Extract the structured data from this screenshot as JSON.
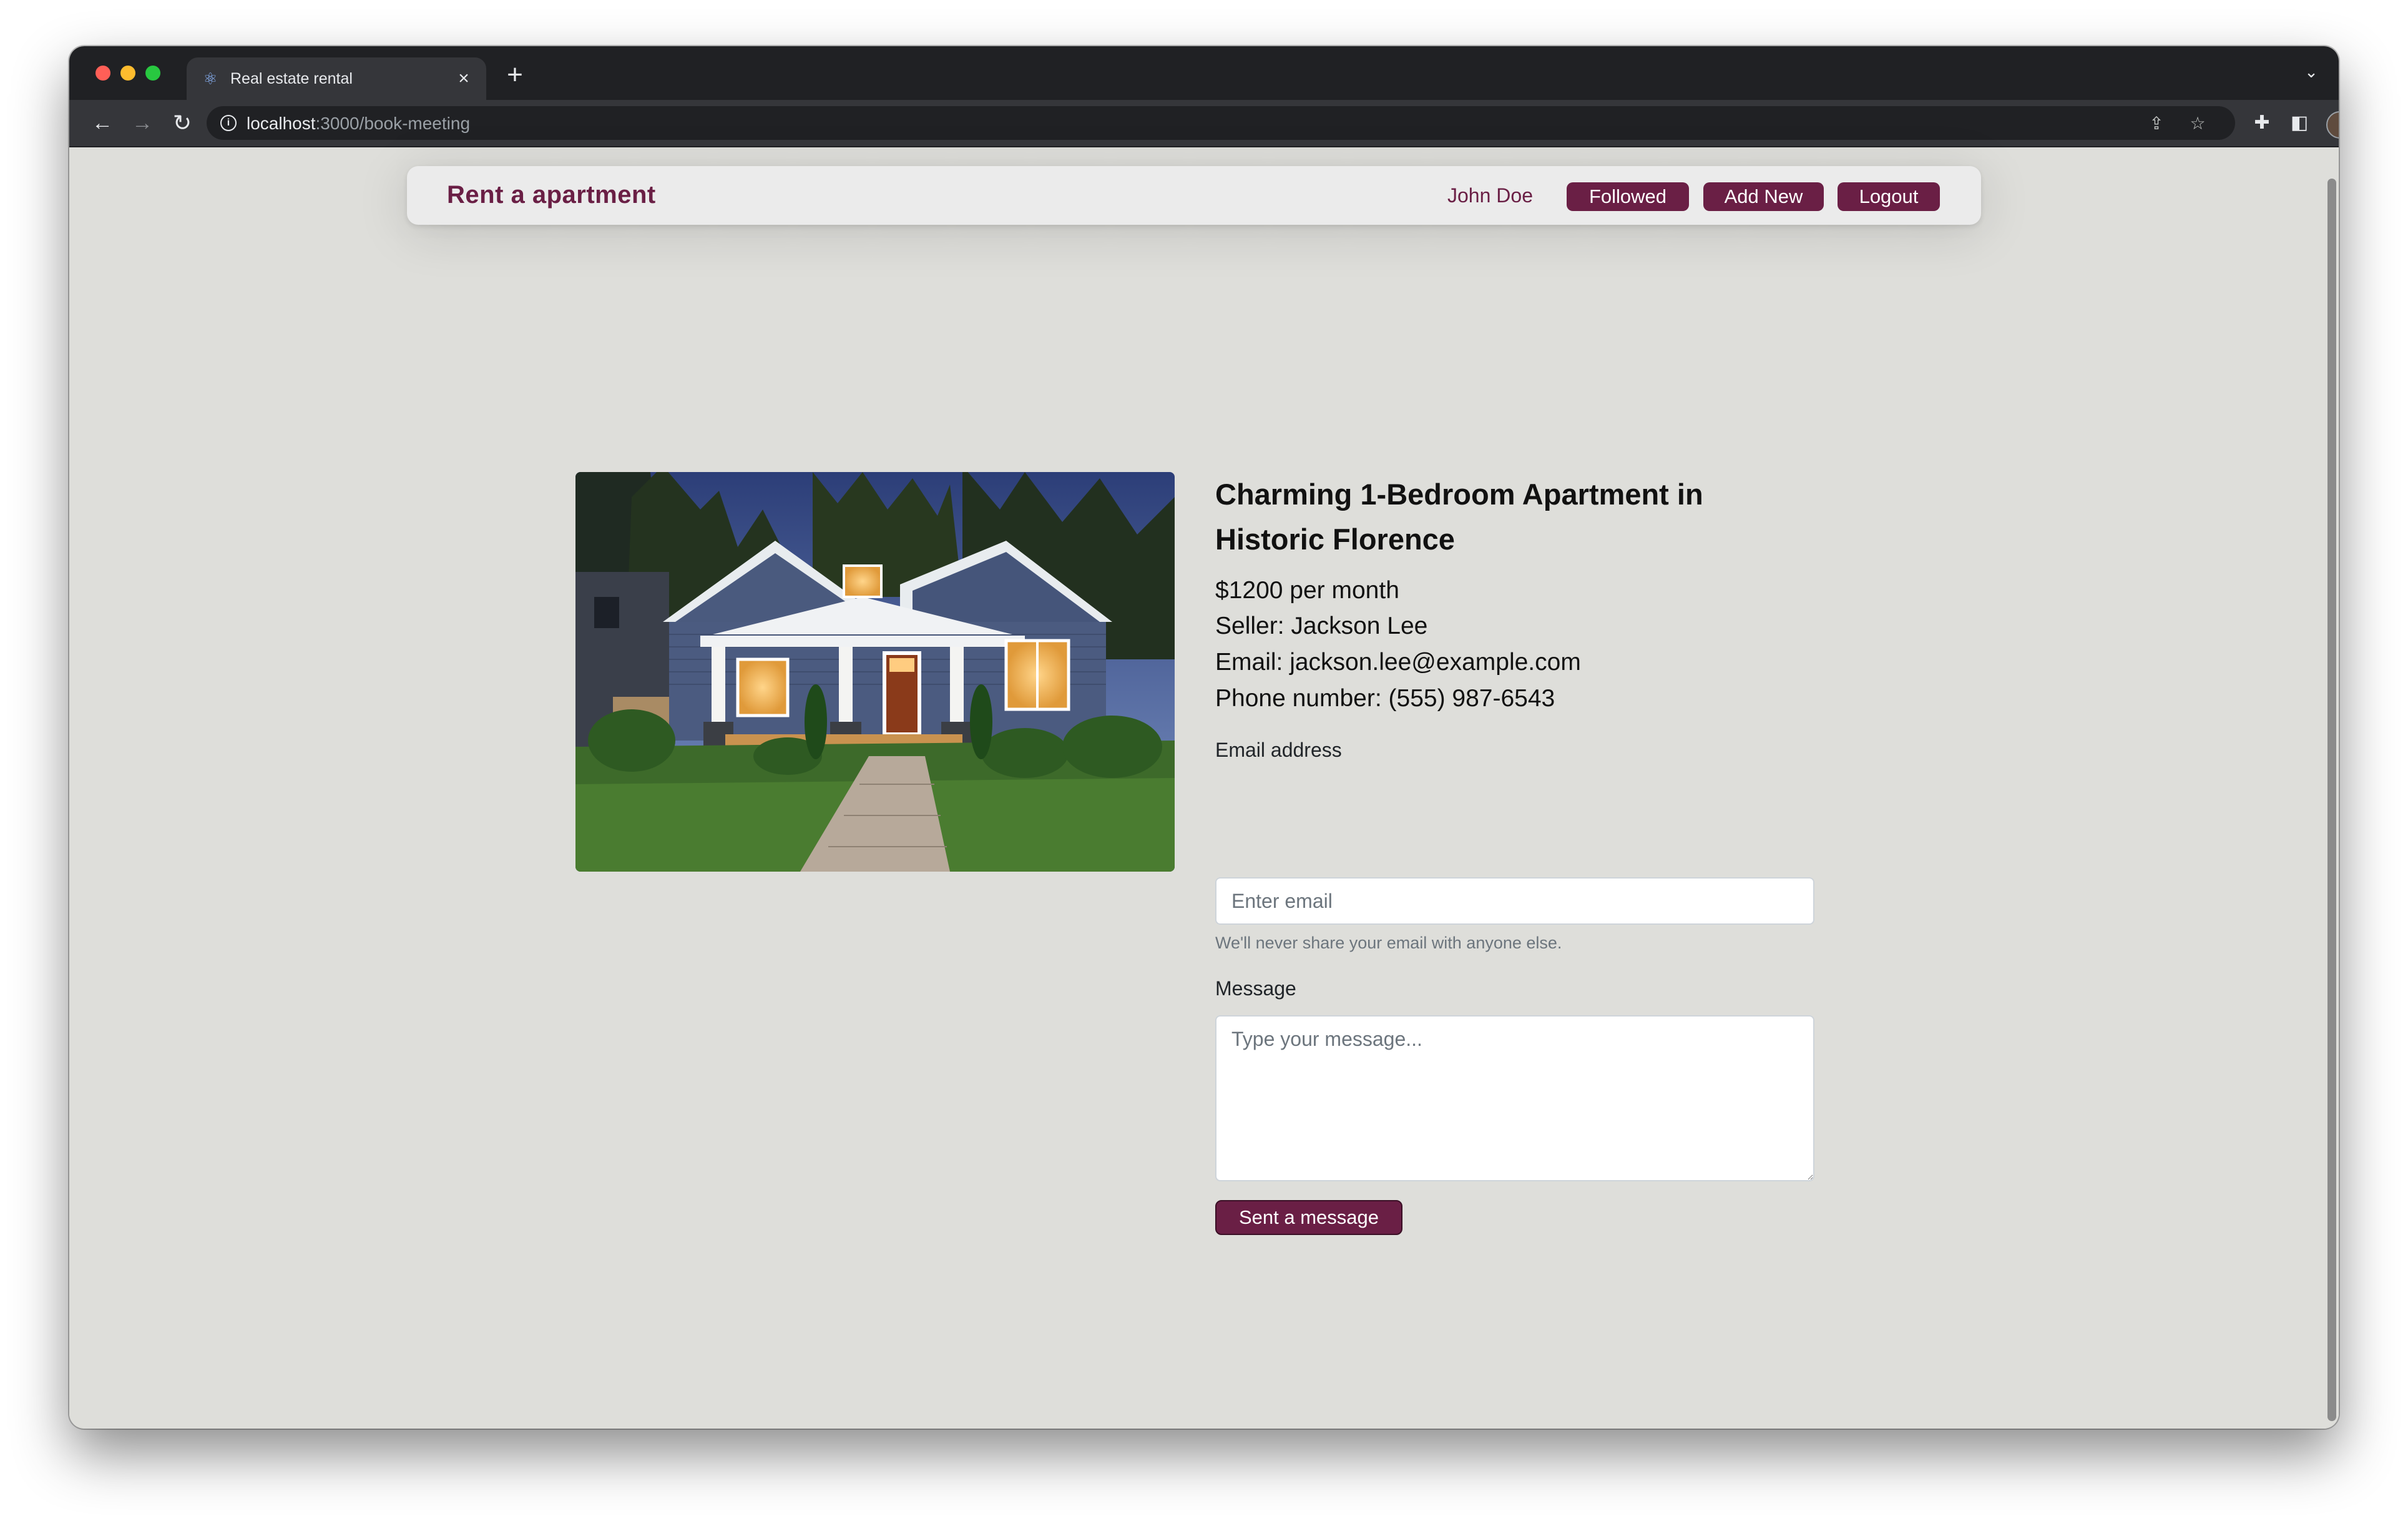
{
  "browser": {
    "tab_title": "Real estate rental",
    "url_host": "localhost",
    "url_path": ":3000/book-meeting",
    "icons": {
      "favicon": "react-icon",
      "close": "close-icon",
      "new_tab": "plus-icon",
      "back": "arrow-left-icon",
      "forward": "arrow-right-icon",
      "reload": "reload-icon",
      "share": "share-icon",
      "bookmark": "star-icon",
      "extensions": "puzzle-icon",
      "side_panel": "side-panel-icon",
      "menu": "kebab-menu-icon"
    }
  },
  "navbar": {
    "brand": "Rent a apartment",
    "user": "John Doe",
    "buttons": {
      "followed": "Followed",
      "add_new": "Add New",
      "logout": "Logout"
    }
  },
  "listing": {
    "title": "Charming 1-Bedroom Apartment in Historic Florence",
    "price": "$1200 per month",
    "seller": "Seller: Jackson Lee",
    "email": "Email: jackson.lee@example.com",
    "phone": "Phone number: (555) 987-6543"
  },
  "form": {
    "email_label": "Email address",
    "email_placeholder": "Enter email",
    "email_value": "",
    "email_help": "We'll never share your email with anyone else.",
    "message_label": "Message",
    "message_placeholder": "Type your message...",
    "message_value": "",
    "submit_label": "Sent a message"
  },
  "colors": {
    "brand": "#6a1f45",
    "page_background": "#dededa",
    "navbar_background": "#ebebeb"
  }
}
